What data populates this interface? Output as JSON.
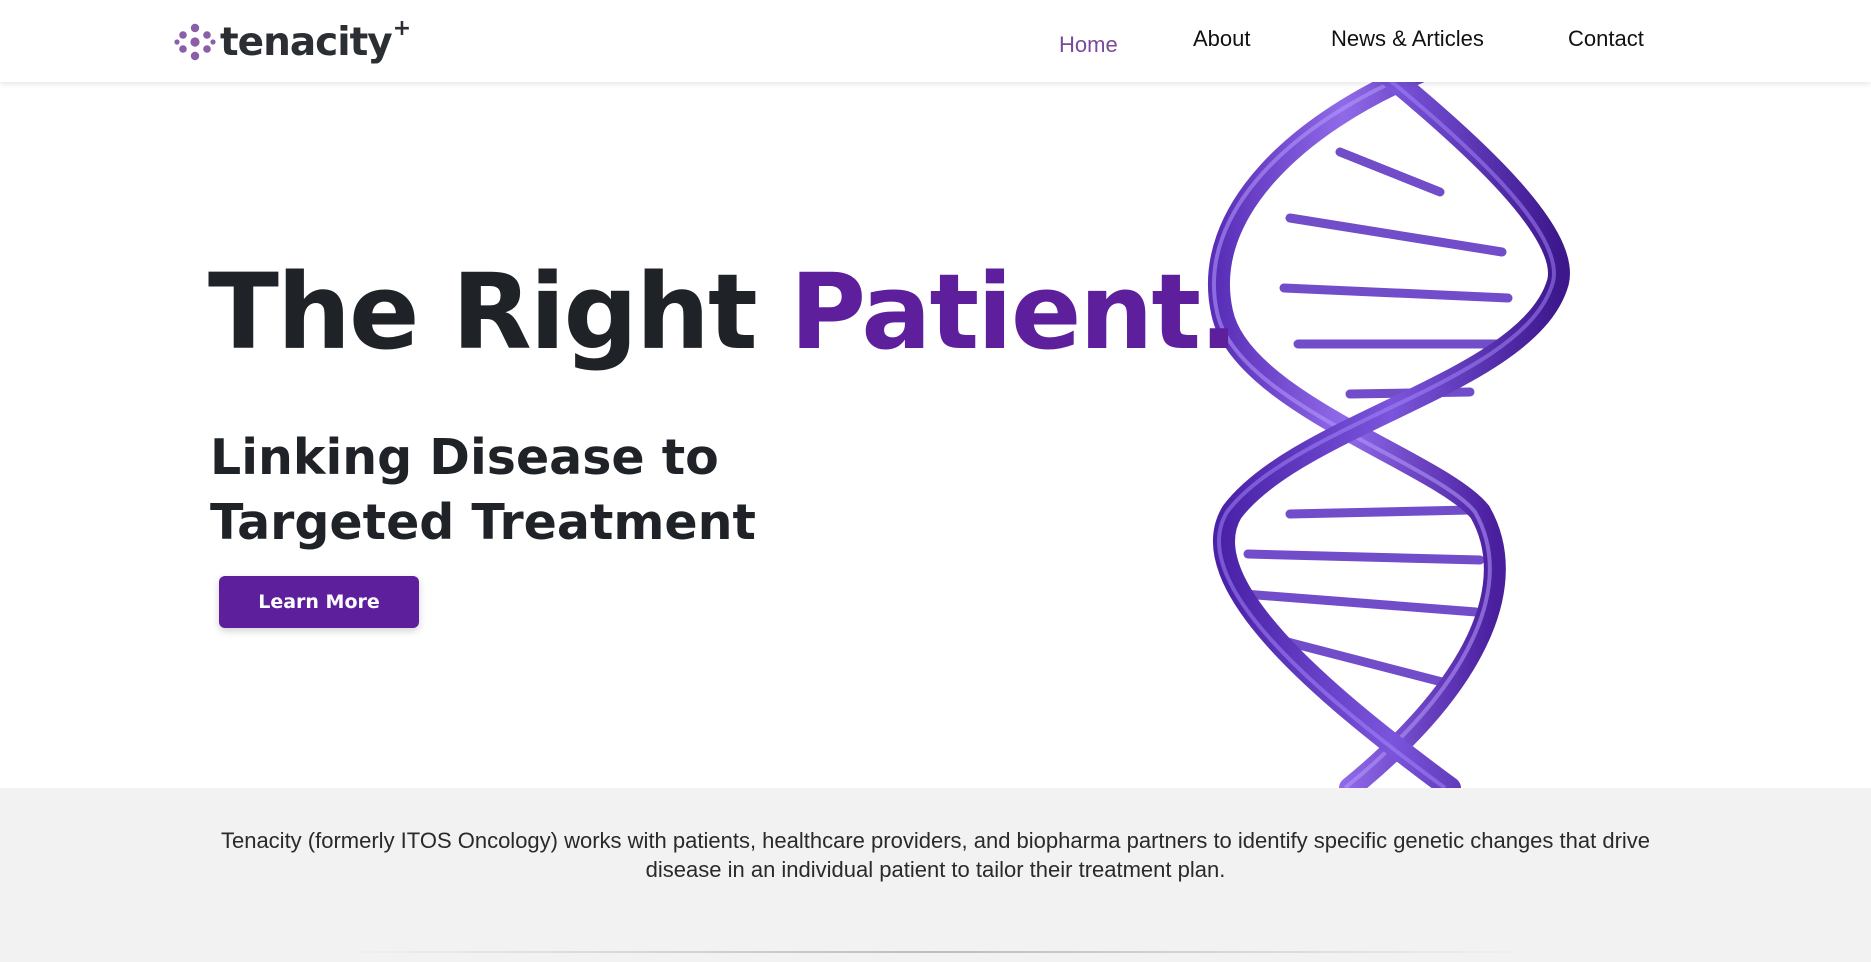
{
  "header": {
    "logo": {
      "text": "tenacity",
      "superscript": "+"
    },
    "nav": [
      {
        "label": "Home",
        "active": true
      },
      {
        "label": "About",
        "active": false
      },
      {
        "label": "News & Articles",
        "active": false
      },
      {
        "label": "Contact",
        "active": false
      }
    ]
  },
  "hero": {
    "headline_main": "The Right ",
    "headline_accent": "Patient.",
    "subheadline": "Linking Disease to Targeted Treatment",
    "cta_label": "Learn More",
    "image": "dna-double-helix"
  },
  "intro": {
    "text": "Tenacity (formerly ITOS Oncology) works with patients, healthcare providers, and biopharma partners to identify specific genetic changes that drive disease in an individual patient to tailor their treatment plan."
  },
  "colors": {
    "brand_purple": "#5e1f9c",
    "nav_active": "#7a4a9a",
    "dna_purple": "#7b52d6",
    "text_dark": "#1f2328",
    "band_bg": "#f2f2f2"
  }
}
